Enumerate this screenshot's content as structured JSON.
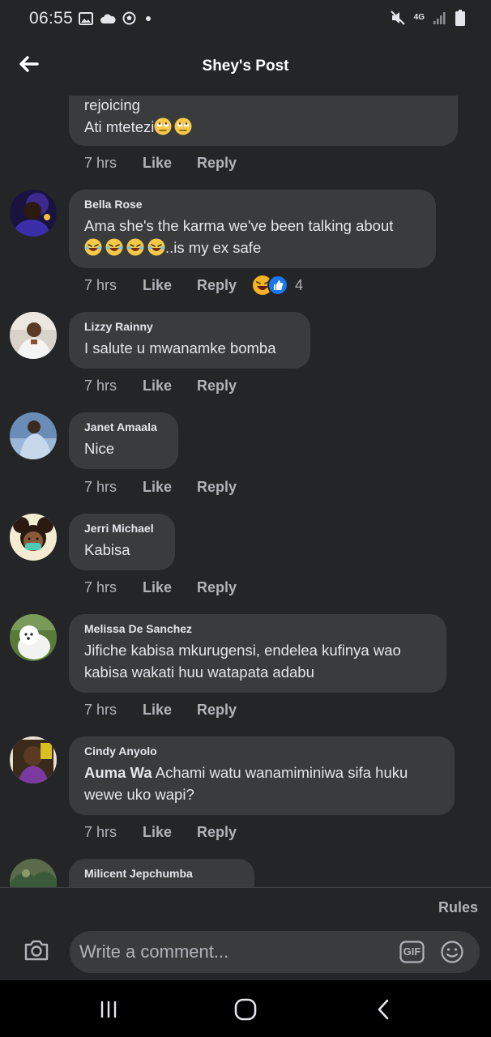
{
  "status_bar": {
    "time": "06:55",
    "network": "4G",
    "left_icons": [
      "gallery-icon",
      "cloud-icon",
      "soccer-ball-icon",
      "dot-icon"
    ],
    "right_icons": [
      "mute-icon",
      "signal-icon",
      "battery-icon"
    ]
  },
  "header": {
    "title": "Shey's Post"
  },
  "top_comment": {
    "lines": [
      "rejoicing",
      "Ati mtetezi"
    ],
    "emoji": [
      "rolling-eyes-emoji",
      "rolling-eyes-emoji"
    ],
    "time": "7 hrs",
    "like": "Like",
    "reply": "Reply"
  },
  "comments": [
    {
      "author": "Bella Rose",
      "line1": "Ama she's the karma we've been talking about",
      "line2": "..is my ex safe",
      "emoji": [
        "rofl-emoji",
        "rofl-emoji",
        "rofl-emoji",
        "rofl-emoji"
      ],
      "time": "7 hrs",
      "like": "Like",
      "reply": "Reply",
      "reaction_count": "4",
      "reaction_icons": [
        "haha-reaction-icon",
        "like-reaction-icon"
      ]
    },
    {
      "author": "Lizzy Rainny",
      "text": "I salute u mwanamke bomba",
      "time": "7 hrs",
      "like": "Like",
      "reply": "Reply"
    },
    {
      "author": "Janet Amaala",
      "text": "Nice",
      "time": "7 hrs",
      "like": "Like",
      "reply": "Reply"
    },
    {
      "author": "Jerri Michael",
      "text": "Kabisa",
      "time": "7 hrs",
      "like": "Like",
      "reply": "Reply"
    },
    {
      "author": "Melissa De Sanchez",
      "line1": "Jifiche kabisa mkurugensi, endelea kufinya wao",
      "line2": "kabisa wakati huu watapata adabu",
      "time": "7 hrs",
      "like": "Like",
      "reply": "Reply"
    },
    {
      "author": "Cindy Anyolo",
      "mention": "Auma Wa",
      "line1_rest": " Achami watu wanamiminiwa sifa huku",
      "line2": "wewe uko wapi?",
      "time": "7 hrs",
      "like": "Like",
      "reply": "Reply"
    },
    {
      "author": "Milicent Jepchumba"
    }
  ],
  "footer": {
    "rules": "Rules",
    "comment_placeholder": "Write a comment...",
    "gif_label": "GIF"
  },
  "colors": {
    "background": "#242526",
    "bubble": "#3a3b3c",
    "text": "#e4e6eb",
    "muted": "#b0b3b8",
    "like_blue": "#1877f2",
    "haha_yellow": "#f7b125"
  }
}
